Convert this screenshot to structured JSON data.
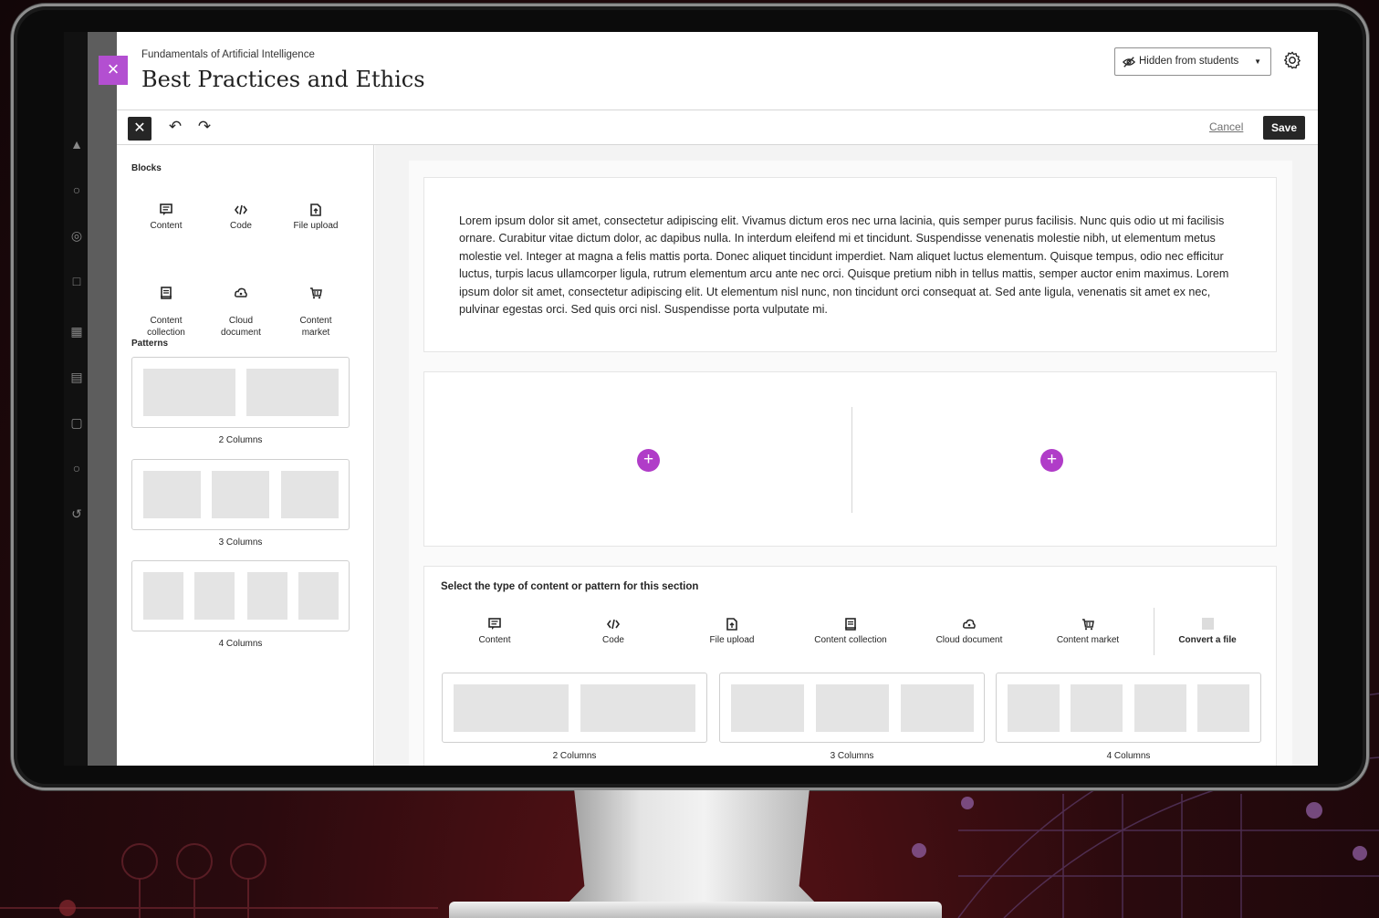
{
  "header": {
    "course_name": "Fundamentals of Artificial Intelligence",
    "page_title": "Best Practices and Ethics",
    "visibility_label": "Hidden from students"
  },
  "toolbar": {
    "cancel_label": "Cancel",
    "save_label": "Save"
  },
  "sidebar": {
    "blocks_heading": "Blocks",
    "blocks": [
      {
        "label": "Content",
        "icon": "content-icon"
      },
      {
        "label": "Code",
        "icon": "code-icon"
      },
      {
        "label": "File upload",
        "icon": "file-upload-icon"
      },
      {
        "label": "Content\ncollection",
        "icon": "content-collection-icon"
      },
      {
        "label": "Cloud\ndocument",
        "icon": "cloud-document-icon"
      },
      {
        "label": "Content\nmarket",
        "icon": "content-market-icon"
      }
    ],
    "patterns_heading": "Patterns",
    "patterns": [
      {
        "label": "2 Columns",
        "columns": 2
      },
      {
        "label": "3 Columns",
        "columns": 3
      },
      {
        "label": "4 Columns",
        "columns": 4
      }
    ]
  },
  "canvas": {
    "text_block": "Lorem ipsum dolor sit amet, consectetur adipiscing elit. Vivamus dictum eros nec urna lacinia, quis semper purus facilisis. Nunc quis odio ut mi facilisis ornare. Curabitur vitae dictum dolor, ac dapibus nulla. In interdum eleifend mi et tincidunt. Suspendisse venenatis molestie nibh, ut elementum metus molestie vel. Integer at magna a felis mattis porta. Donec aliquet tincidunt imperdiet. Nam aliquet luctus elementum. Quisque tempus, odio nec efficitur luctus, turpis lacus ullamcorper ligula, rutrum elementum arcu ante nec orci. Quisque pretium nibh in tellus mattis, semper auctor enim maximus. Lorem ipsum dolor sit amet, consectetur adipiscing elit. Ut elementum nisl nunc, non tincidunt orci consequat at. Sed ante ligula, venenatis sit amet ex nec, pulvinar egestas orci. Sed quis orci nisl. Suspendisse porta vulputate mi.",
    "picker": {
      "title": "Select the type of content or pattern for this section",
      "items": [
        {
          "label": "Content",
          "icon": "content-icon"
        },
        {
          "label": "Code",
          "icon": "code-icon"
        },
        {
          "label": "File upload",
          "icon": "file-upload-icon"
        },
        {
          "label": "Content collection",
          "icon": "content-collection-icon"
        },
        {
          "label": "Cloud document",
          "icon": "cloud-document-icon"
        },
        {
          "label": "Content market",
          "icon": "content-market-icon"
        }
      ],
      "convert_label": "Convert a file",
      "patterns": [
        {
          "label": "2 Columns",
          "columns": 2
        },
        {
          "label": "3 Columns",
          "columns": 3
        },
        {
          "label": "4 Columns",
          "columns": 4
        }
      ]
    }
  },
  "colors": {
    "accent": "#b03cc8",
    "dark": "#262626"
  }
}
